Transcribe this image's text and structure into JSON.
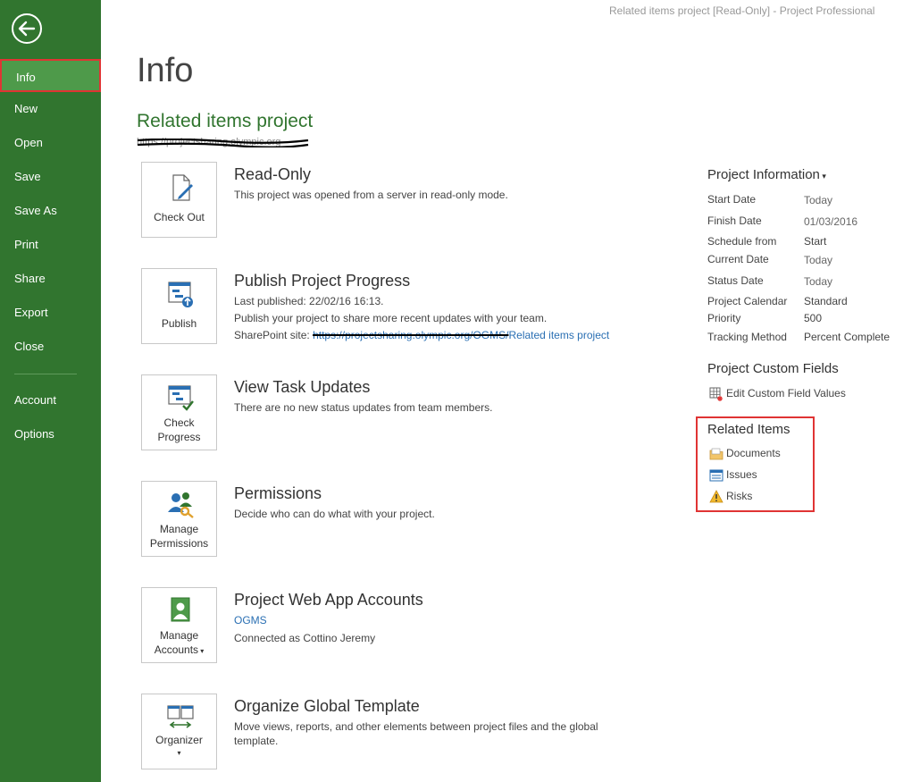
{
  "window_title": "Related items project [Read-Only] - Project Professional",
  "nav": {
    "back": "back-arrow-icon",
    "items": [
      "Info",
      "New",
      "Open",
      "Save",
      "Save As",
      "Print",
      "Share",
      "Export",
      "Close",
      "Account",
      "Options"
    ]
  },
  "page": {
    "title": "Info",
    "project_name": "Related items project",
    "project_url": "https://projectsharing.olympic.org"
  },
  "sections": {
    "readonly": {
      "tile": "Check Out",
      "title": "Read-Only",
      "text": "This project was opened from a server in read-only mode."
    },
    "publish": {
      "tile": "Publish",
      "title": "Publish Project Progress",
      "last_published": "Last published: 22/02/16 16:13.",
      "text": "Publish your project to share more recent updates with your team.",
      "sp_prefix": "SharePoint site: ",
      "sp_url": "https://projectsharing.olympic.org/OGMS/",
      "sp_link": "Related items project"
    },
    "updates": {
      "tile1": "Check",
      "tile2": "Progress",
      "title": "View Task Updates",
      "text": "There are no new status updates from team members."
    },
    "permissions": {
      "tile1": "Manage",
      "tile2": "Permissions",
      "title": "Permissions",
      "text": "Decide who can do what with your project."
    },
    "accounts": {
      "tile1": "Manage",
      "tile2": "Accounts",
      "title": "Project Web App Accounts",
      "link": "OGMS",
      "text": "Connected as Cottino Jeremy"
    },
    "organizer": {
      "tile": "Organizer",
      "title": "Organize Global Template",
      "text1": "Move views, reports, and other elements between project files and the global",
      "text2": "template."
    }
  },
  "project_info": {
    "title": "Project Information",
    "rows": [
      {
        "label": "Start Date",
        "value": "Today"
      },
      {
        "label": "Finish Date",
        "value": "01/03/2016"
      },
      {
        "label": "Schedule from",
        "value": "Start"
      },
      {
        "label": "Current Date",
        "value": "Today"
      },
      {
        "label": "Status Date",
        "value": "Today"
      },
      {
        "label": "Project Calendar",
        "value": "Standard"
      },
      {
        "label": "Priority",
        "value": "500"
      },
      {
        "label": "Tracking Method",
        "value": "Percent Complete"
      }
    ]
  },
  "custom_fields": {
    "title": "Project Custom Fields",
    "link": "Edit Custom Field Values"
  },
  "related_items": {
    "title": "Related Items",
    "items": [
      "Documents",
      "Issues",
      "Risks"
    ]
  },
  "colors": {
    "accent": "#31752f",
    "highlight": "#e03434",
    "link": "#2a6fb3"
  }
}
